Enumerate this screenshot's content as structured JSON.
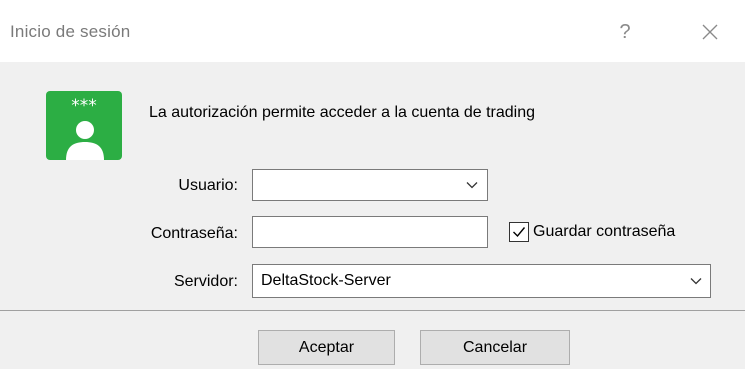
{
  "window": {
    "title": "Inicio de sesión",
    "help_glyph": "?",
    "close_icon": "close-icon"
  },
  "header": {
    "icon": "user-password-icon",
    "icon_stars": "***",
    "icon_color": "#2cae44",
    "message": "La autorización permite acceder a la cuenta de trading"
  },
  "form": {
    "user": {
      "label": "Usuario:",
      "value": ""
    },
    "password": {
      "label": "Contraseña:",
      "value": ""
    },
    "save_password": {
      "label": "Guardar contraseña",
      "checked": true
    },
    "server": {
      "label": "Servidor:",
      "value": "DeltaStock-Server"
    }
  },
  "buttons": {
    "ok_label": "Aceptar",
    "cancel_label": "Cancelar"
  }
}
